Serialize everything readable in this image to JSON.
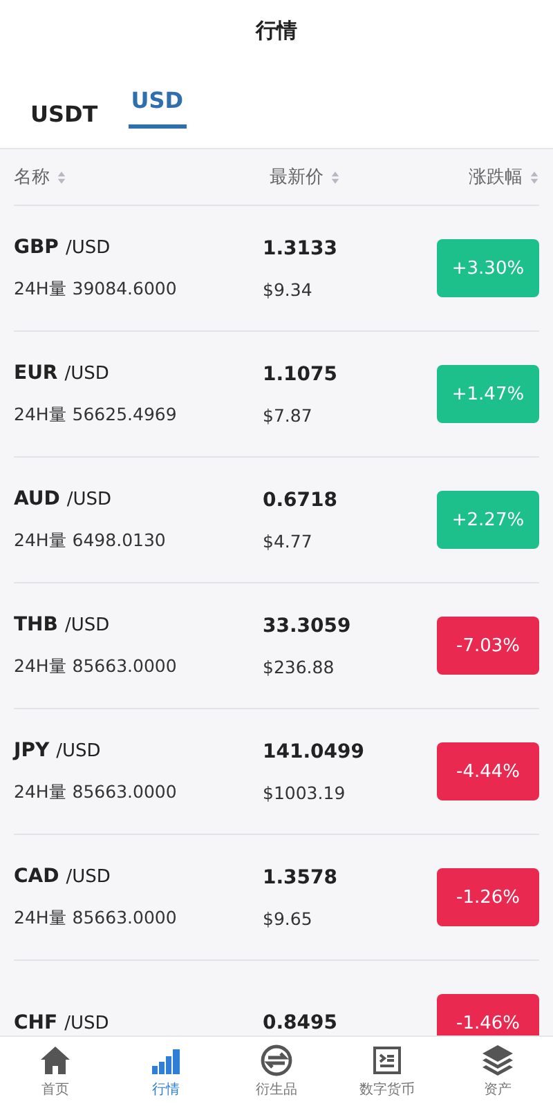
{
  "header": {
    "title": "行情"
  },
  "tabs": [
    {
      "label": "USDT",
      "selected": false
    },
    {
      "label": "USD",
      "selected": true
    }
  ],
  "table": {
    "columns": [
      "名称",
      "最新价",
      "涨跌幅"
    ],
    "rows": [
      {
        "base": "GBP",
        "quote": "/USD",
        "volume": "24H量 39084.6000",
        "price": "1.3133",
        "usd": "$9.34",
        "change": "+3.30%",
        "kind": "up"
      },
      {
        "base": "EUR",
        "quote": "/USD",
        "volume": "24H量 56625.4969",
        "price": "1.1075",
        "usd": "$7.87",
        "change": "+1.47%",
        "kind": "up"
      },
      {
        "base": "AUD",
        "quote": "/USD",
        "volume": "24H量 6498.0130",
        "price": "0.6718",
        "usd": "$4.77",
        "change": "+2.27%",
        "kind": "up"
      },
      {
        "base": "THB",
        "quote": "/USD",
        "volume": "24H量 85663.0000",
        "price": "33.3059",
        "usd": "$236.88",
        "change": "-7.03%",
        "kind": "down"
      },
      {
        "base": "JPY",
        "quote": "/USD",
        "volume": "24H量 85663.0000",
        "price": "141.0499",
        "usd": "$1003.19",
        "change": "-4.44%",
        "kind": "down"
      },
      {
        "base": "CAD",
        "quote": "/USD",
        "volume": "24H量 85663.0000",
        "price": "1.3578",
        "usd": "$9.65",
        "change": "-1.26%",
        "kind": "down"
      },
      {
        "base": "CHF",
        "quote": "/USD",
        "price": "0.8495",
        "change": "-1.46%",
        "kind": "down"
      }
    ]
  },
  "nav": [
    {
      "label": "首页",
      "kind": "home",
      "selected": false
    },
    {
      "label": "行情",
      "kind": "chart",
      "selected": true
    },
    {
      "label": "衍生品",
      "kind": "exchange",
      "selected": false
    },
    {
      "label": "数字货币",
      "kind": "document",
      "selected": false
    },
    {
      "label": "资产",
      "kind": "layers",
      "selected": false
    }
  ]
}
